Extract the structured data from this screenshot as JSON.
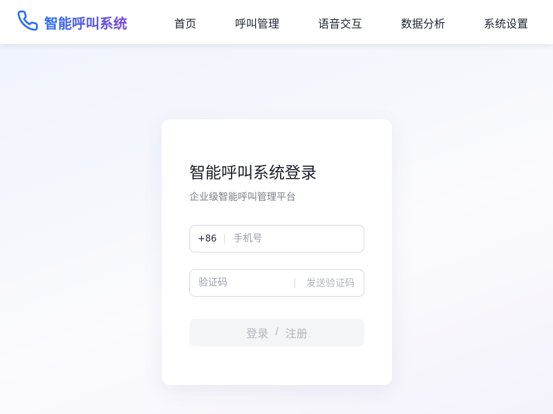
{
  "header": {
    "brand_name": "智能呼叫系统",
    "brand_icon": "phone-icon",
    "nav": [
      {
        "label": "首页"
      },
      {
        "label": "呼叫管理"
      },
      {
        "label": "语音交互"
      },
      {
        "label": "数据分析"
      },
      {
        "label": "系统设置"
      }
    ]
  },
  "login": {
    "title": "智能呼叫系统登录",
    "subtitle": "企业级智能呼叫管理平台",
    "phone": {
      "prefix": "+86",
      "placeholder": "手机号",
      "value": ""
    },
    "code": {
      "placeholder": "验证码",
      "value": "",
      "send_label": "发送验证码"
    },
    "submit": {
      "login_label": "登录",
      "separator": "/",
      "register_label": "注册"
    }
  },
  "colors": {
    "brand_gradient_start": "#2b6cf5",
    "brand_gradient_end": "#7a45e0",
    "icon": "#2b6cf5"
  }
}
